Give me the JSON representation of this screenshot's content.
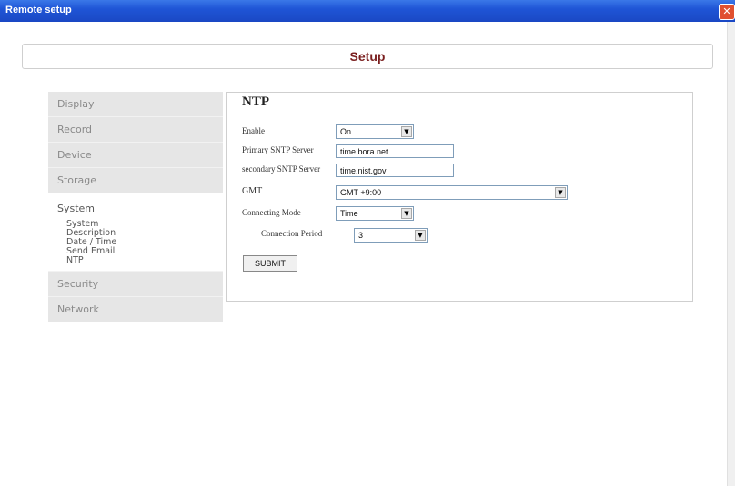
{
  "window": {
    "title": "Remote setup",
    "close_glyph": "✕"
  },
  "header": {
    "title": "Setup"
  },
  "sidebar": {
    "items_top": [
      "Display",
      "Record",
      "Device",
      "Storage"
    ],
    "system": {
      "label": "System",
      "subitems": [
        "System",
        "Description",
        "Date / Time",
        "Send Email",
        "NTP"
      ]
    },
    "items_bottom": [
      "Security",
      "Network"
    ]
  },
  "ntp": {
    "title": "NTP",
    "enable_label": "Enable",
    "enable_value": "On",
    "primary_label": "Primary SNTP Server",
    "primary_value": "time.bora.net",
    "secondary_label": "secondary SNTP Server",
    "secondary_value": "time.nist.gov",
    "gmt_label": "GMT",
    "gmt_value": "GMT +9:00",
    "mode_label": "Connecting Mode",
    "mode_value": "Time",
    "period_label": "Connection Period",
    "period_value": "3",
    "submit_label": "SUBMIT"
  },
  "icons": {
    "dropdown": "chevron-down-icon",
    "close": "close-icon"
  }
}
